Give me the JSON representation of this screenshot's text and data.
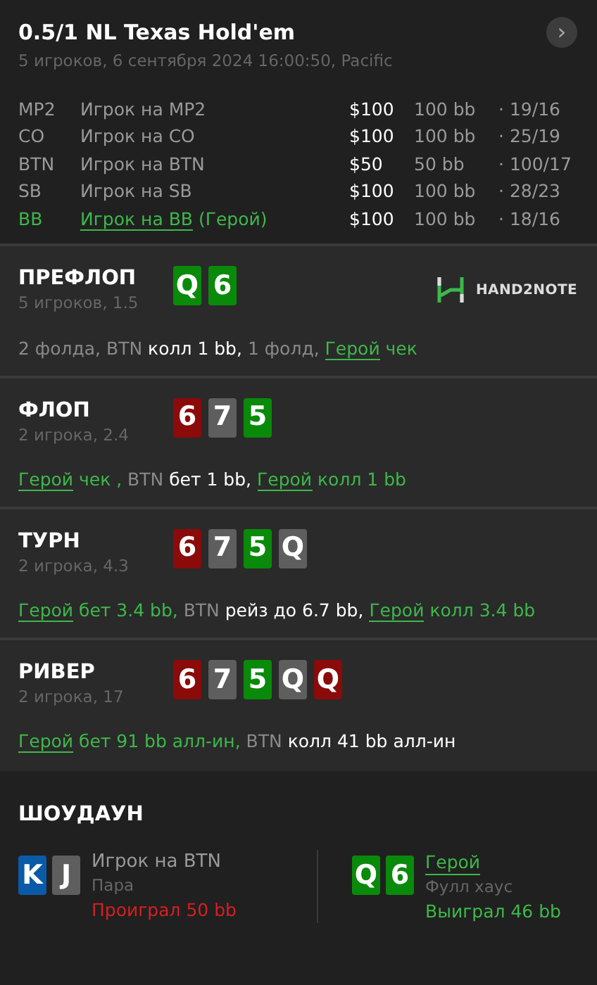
{
  "header": {
    "title": "0.5/1 NL Texas Hold'em",
    "subtitle": "5 игроков, 6 сентября 2024 16:00:50, Pacific",
    "next_button": "›"
  },
  "players": [
    {
      "position": "MP2",
      "name": "Игрок на MP2",
      "hero": false,
      "stack": "$100",
      "bb": "100 bb",
      "stats": "· 19/16"
    },
    {
      "position": "CO",
      "name": "Игрок на CO",
      "hero": false,
      "stack": "$100",
      "bb": "100 bb",
      "stats": "· 25/19"
    },
    {
      "position": "BTN",
      "name": "Игрок на BTN",
      "hero": false,
      "stack": "$50",
      "bb": "50 bb",
      "stats": "· 100/17"
    },
    {
      "position": "SB",
      "name": "Игрок на SB",
      "hero": false,
      "stack": "$100",
      "bb": "100 bb",
      "stats": "· 28/23"
    },
    {
      "position": "BB",
      "name": "Игрок на BB",
      "hero_tag": "(Герой)",
      "hero": true,
      "stack": "$100",
      "bb": "100 bb",
      "stats": "· 18/16"
    }
  ],
  "streets": [
    {
      "name": "ПРЕФЛОП",
      "info": "5 игроков, 1.5",
      "logo": "HAND2NOTE",
      "cards": [
        {
          "rank": "Q",
          "color": "#0a8a0a"
        },
        {
          "rank": "6",
          "color": "#0a8a0a"
        }
      ],
      "actions": [
        {
          "text": "2 фолда, BTN ",
          "kind": "muted"
        },
        {
          "text": "колл 1 bb,",
          "kind": "bright"
        },
        {
          "text": " 1 фолд, ",
          "kind": "muted"
        },
        {
          "text": "Герой",
          "kind": "hero_link"
        },
        {
          "text": " чек",
          "kind": "hero"
        }
      ]
    },
    {
      "name": "ФЛОП",
      "info": "2 игрока, 2.4",
      "cards": [
        {
          "rank": "6",
          "color": "#8b0a0a"
        },
        {
          "rank": "7",
          "color": "#5e5e5e"
        },
        {
          "rank": "5",
          "color": "#0a8a0a"
        }
      ],
      "actions": [
        {
          "text": "Герой",
          "kind": "hero_link"
        },
        {
          "text": " чек ,",
          "kind": "hero"
        },
        {
          "text": " BTN ",
          "kind": "muted"
        },
        {
          "text": "бет 1 bb, ",
          "kind": "bright"
        },
        {
          "text": "Герой",
          "kind": "hero_link"
        },
        {
          "text": " колл 1 bb",
          "kind": "hero"
        }
      ]
    },
    {
      "name": "ТУРН",
      "info": "2 игрока, 4.3",
      "cards": [
        {
          "rank": "6",
          "color": "#8b0a0a"
        },
        {
          "rank": "7",
          "color": "#5e5e5e"
        },
        {
          "rank": "5",
          "color": "#0a8a0a"
        },
        {
          "rank": "Q",
          "color": "#5e5e5e"
        }
      ],
      "actions": [
        {
          "text": "Герой",
          "kind": "hero_link"
        },
        {
          "text": " бет 3.4 bb,",
          "kind": "hero"
        },
        {
          "text": " BTN ",
          "kind": "muted"
        },
        {
          "text": "рейз до 6.7 bb, ",
          "kind": "bright"
        },
        {
          "text": "Герой",
          "kind": "hero_link"
        },
        {
          "text": " колл 3.4 bb",
          "kind": "hero"
        }
      ]
    },
    {
      "name": "РИВЕР",
      "info": "2 игрока, 17",
      "cards": [
        {
          "rank": "6",
          "color": "#8b0a0a"
        },
        {
          "rank": "7",
          "color": "#5e5e5e"
        },
        {
          "rank": "5",
          "color": "#0a8a0a"
        },
        {
          "rank": "Q",
          "color": "#5e5e5e"
        },
        {
          "rank": "Q",
          "color": "#8b0a0a"
        }
      ],
      "actions": [
        {
          "text": "Герой",
          "kind": "hero_link"
        },
        {
          "text": " бет 91 bb алл-ин,",
          "kind": "hero"
        },
        {
          "text": " BTN ",
          "kind": "muted"
        },
        {
          "text": "колл 41 bb алл-ин",
          "kind": "bright"
        }
      ]
    }
  ],
  "showdown": {
    "title": "ШОУДАУН",
    "players": [
      {
        "name": "Игрок на BTN",
        "hero": false,
        "won": false,
        "hand": "Пара",
        "result": "Проиграл 50 bb",
        "cards": [
          {
            "rank": "K",
            "color": "#0b5aa8"
          },
          {
            "rank": "J",
            "color": "#5e5e5e"
          }
        ]
      },
      {
        "name": "Герой",
        "hero": true,
        "won": true,
        "hand": "Фулл хаус",
        "result": "Выиграл 46 bb",
        "cards": [
          {
            "rank": "Q",
            "color": "#0a8a0a"
          },
          {
            "rank": "6",
            "color": "#0a8a0a"
          }
        ]
      }
    ]
  }
}
